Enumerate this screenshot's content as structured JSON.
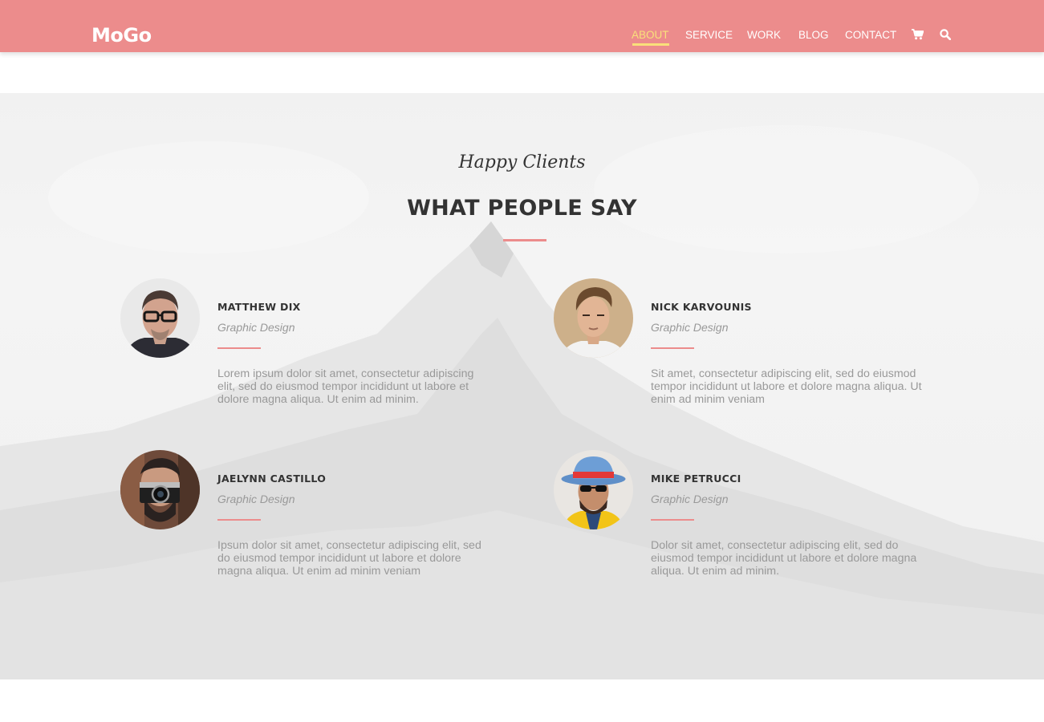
{
  "header": {
    "logo": "MoGo",
    "nav": [
      {
        "label": "ABOUT",
        "active": true
      },
      {
        "label": "SERVICE",
        "active": false
      },
      {
        "label": "WORK",
        "active": false
      },
      {
        "label": "BLOG",
        "active": false
      },
      {
        "label": "CONTACT",
        "active": false
      }
    ],
    "icons": [
      "cart-icon",
      "search-icon"
    ]
  },
  "section": {
    "script_title": "Happy Clients",
    "title": "WHAT PEOPLE SAY"
  },
  "testimonials": [
    {
      "name": "MATTHEW DIX",
      "role": "Graphic Design",
      "quote": "Lorem ipsum dolor sit amet, consectetur adipiscing elit, sed do eiusmod tempor incididunt ut labore et dolore magna aliqua. Ut enim ad minim."
    },
    {
      "name": "NICK KARVOUNIS",
      "role": "Graphic Design",
      "quote": "Sit amet, consectetur adipiscing elit, sed do eiusmod tempor incididunt ut labore et dolore magna aliqua. Ut enim ad minim veniam"
    },
    {
      "name": "JAELYNN CASTILLO",
      "role": "Graphic Design",
      "quote": "Ipsum dolor sit amet, consectetur adipiscing elit, sed do eiusmod tempor incididunt ut labore et dolore magna aliqua. Ut enim ad minim veniam"
    },
    {
      "name": "MIKE PETRUCCI",
      "role": "Graphic Design",
      "quote": "Dolor sit amet, consectetur adipiscing elit, sed do eiusmod tempor incididunt ut labore et dolore magna aliqua. Ut enim ad minim."
    }
  ],
  "colors": {
    "brand": "#ec8c8c",
    "nav_active": "#f9e07a",
    "heading": "#333333",
    "muted_text": "#999999"
  }
}
